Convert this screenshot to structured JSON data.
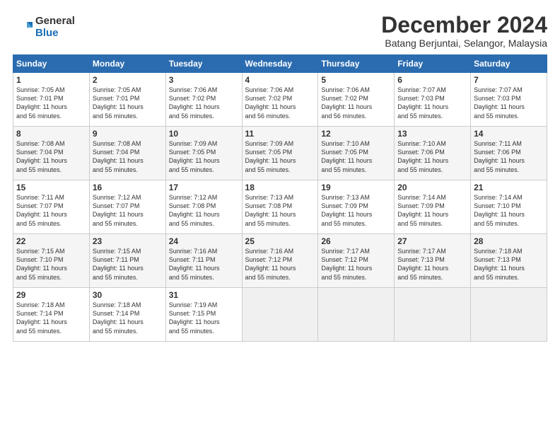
{
  "header": {
    "logo_general": "General",
    "logo_blue": "Blue",
    "title": "December 2024",
    "subtitle": "Batang Berjuntai, Selangor, Malaysia"
  },
  "days_of_week": [
    "Sunday",
    "Monday",
    "Tuesday",
    "Wednesday",
    "Thursday",
    "Friday",
    "Saturday"
  ],
  "weeks": [
    [
      {
        "day": "1",
        "info": "Sunrise: 7:05 AM\nSunset: 7:01 PM\nDaylight: 11 hours\nand 56 minutes."
      },
      {
        "day": "2",
        "info": "Sunrise: 7:05 AM\nSunset: 7:01 PM\nDaylight: 11 hours\nand 56 minutes."
      },
      {
        "day": "3",
        "info": "Sunrise: 7:06 AM\nSunset: 7:02 PM\nDaylight: 11 hours\nand 56 minutes."
      },
      {
        "day": "4",
        "info": "Sunrise: 7:06 AM\nSunset: 7:02 PM\nDaylight: 11 hours\nand 56 minutes."
      },
      {
        "day": "5",
        "info": "Sunrise: 7:06 AM\nSunset: 7:02 PM\nDaylight: 11 hours\nand 56 minutes."
      },
      {
        "day": "6",
        "info": "Sunrise: 7:07 AM\nSunset: 7:03 PM\nDaylight: 11 hours\nand 55 minutes."
      },
      {
        "day": "7",
        "info": "Sunrise: 7:07 AM\nSunset: 7:03 PM\nDaylight: 11 hours\nand 55 minutes."
      }
    ],
    [
      {
        "day": "8",
        "info": "Sunrise: 7:08 AM\nSunset: 7:04 PM\nDaylight: 11 hours\nand 55 minutes."
      },
      {
        "day": "9",
        "info": "Sunrise: 7:08 AM\nSunset: 7:04 PM\nDaylight: 11 hours\nand 55 minutes."
      },
      {
        "day": "10",
        "info": "Sunrise: 7:09 AM\nSunset: 7:05 PM\nDaylight: 11 hours\nand 55 minutes."
      },
      {
        "day": "11",
        "info": "Sunrise: 7:09 AM\nSunset: 7:05 PM\nDaylight: 11 hours\nand 55 minutes."
      },
      {
        "day": "12",
        "info": "Sunrise: 7:10 AM\nSunset: 7:05 PM\nDaylight: 11 hours\nand 55 minutes."
      },
      {
        "day": "13",
        "info": "Sunrise: 7:10 AM\nSunset: 7:06 PM\nDaylight: 11 hours\nand 55 minutes."
      },
      {
        "day": "14",
        "info": "Sunrise: 7:11 AM\nSunset: 7:06 PM\nDaylight: 11 hours\nand 55 minutes."
      }
    ],
    [
      {
        "day": "15",
        "info": "Sunrise: 7:11 AM\nSunset: 7:07 PM\nDaylight: 11 hours\nand 55 minutes."
      },
      {
        "day": "16",
        "info": "Sunrise: 7:12 AM\nSunset: 7:07 PM\nDaylight: 11 hours\nand 55 minutes."
      },
      {
        "day": "17",
        "info": "Sunrise: 7:12 AM\nSunset: 7:08 PM\nDaylight: 11 hours\nand 55 minutes."
      },
      {
        "day": "18",
        "info": "Sunrise: 7:13 AM\nSunset: 7:08 PM\nDaylight: 11 hours\nand 55 minutes."
      },
      {
        "day": "19",
        "info": "Sunrise: 7:13 AM\nSunset: 7:09 PM\nDaylight: 11 hours\nand 55 minutes."
      },
      {
        "day": "20",
        "info": "Sunrise: 7:14 AM\nSunset: 7:09 PM\nDaylight: 11 hours\nand 55 minutes."
      },
      {
        "day": "21",
        "info": "Sunrise: 7:14 AM\nSunset: 7:10 PM\nDaylight: 11 hours\nand 55 minutes."
      }
    ],
    [
      {
        "day": "22",
        "info": "Sunrise: 7:15 AM\nSunset: 7:10 PM\nDaylight: 11 hours\nand 55 minutes."
      },
      {
        "day": "23",
        "info": "Sunrise: 7:15 AM\nSunset: 7:11 PM\nDaylight: 11 hours\nand 55 minutes."
      },
      {
        "day": "24",
        "info": "Sunrise: 7:16 AM\nSunset: 7:11 PM\nDaylight: 11 hours\nand 55 minutes."
      },
      {
        "day": "25",
        "info": "Sunrise: 7:16 AM\nSunset: 7:12 PM\nDaylight: 11 hours\nand 55 minutes."
      },
      {
        "day": "26",
        "info": "Sunrise: 7:17 AM\nSunset: 7:12 PM\nDaylight: 11 hours\nand 55 minutes."
      },
      {
        "day": "27",
        "info": "Sunrise: 7:17 AM\nSunset: 7:13 PM\nDaylight: 11 hours\nand 55 minutes."
      },
      {
        "day": "28",
        "info": "Sunrise: 7:18 AM\nSunset: 7:13 PM\nDaylight: 11 hours\nand 55 minutes."
      }
    ],
    [
      {
        "day": "29",
        "info": "Sunrise: 7:18 AM\nSunset: 7:14 PM\nDaylight: 11 hours\nand 55 minutes."
      },
      {
        "day": "30",
        "info": "Sunrise: 7:18 AM\nSunset: 7:14 PM\nDaylight: 11 hours\nand 55 minutes."
      },
      {
        "day": "31",
        "info": "Sunrise: 7:19 AM\nSunset: 7:15 PM\nDaylight: 11 hours\nand 55 minutes."
      },
      {
        "day": "",
        "info": ""
      },
      {
        "day": "",
        "info": ""
      },
      {
        "day": "",
        "info": ""
      },
      {
        "day": "",
        "info": ""
      }
    ]
  ]
}
